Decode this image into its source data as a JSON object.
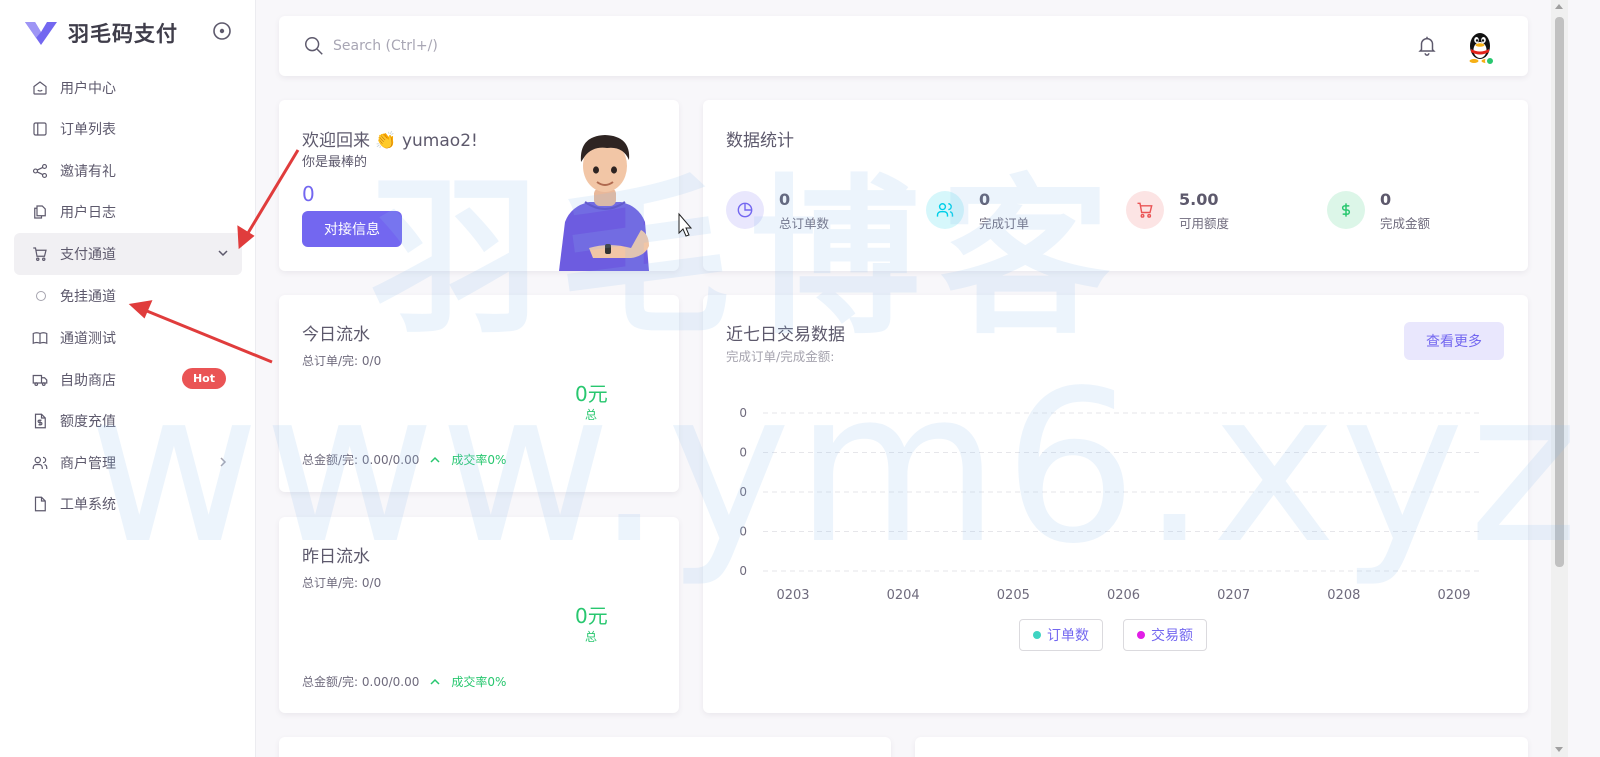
{
  "brand": {
    "name": "羽毛码支付"
  },
  "sidebar": {
    "items": [
      {
        "label": "用户中心",
        "icon": "home-icon"
      },
      {
        "label": "订单列表",
        "icon": "layout-icon"
      },
      {
        "label": "邀请有礼",
        "icon": "share-icon"
      },
      {
        "label": "用户日志",
        "icon": "files-icon"
      },
      {
        "label": "支付通道",
        "icon": "cart-icon",
        "expanded": true
      },
      {
        "label": "免挂通道",
        "icon": "circle-icon",
        "sub": true
      },
      {
        "label": "通道测试",
        "icon": "book-icon"
      },
      {
        "label": "自助商店",
        "icon": "truck-icon",
        "badge": "Hot"
      },
      {
        "label": "额度充值",
        "icon": "file-dollar-icon"
      },
      {
        "label": "商户管理",
        "icon": "users-icon"
      },
      {
        "label": "工单系统",
        "icon": "file-icon"
      }
    ]
  },
  "navbar": {
    "search_placeholder": "Search (Ctrl+/)"
  },
  "welcome": {
    "title": "欢迎回来 👏 yumao2!",
    "subtitle": "你是最棒的",
    "value": "0",
    "button": "对接信息"
  },
  "stats": {
    "title": "数据统计",
    "items": [
      {
        "value": "0",
        "label": "总订单数",
        "color": "#7367f0",
        "bg": "#e9e7fd",
        "icon": "pie-chart-icon"
      },
      {
        "value": "0",
        "label": "完成订单",
        "color": "#00cfe8",
        "bg": "#d6f7fb",
        "icon": "users-icon"
      },
      {
        "value": "5.00",
        "label": "可用额度",
        "color": "#ea5455",
        "bg": "#fce4e4",
        "icon": "cart-icon"
      },
      {
        "value": "0",
        "label": "完成金额",
        "color": "#28c76f",
        "bg": "#dcf6e8",
        "icon": "dollar-icon"
      }
    ]
  },
  "today": {
    "title": "今日流水",
    "orders": "总订单/完: 0/0",
    "amount": "0元",
    "total": "总",
    "foot_amount": "总金额/完: 0.00/0.00",
    "rate": "成交率0%"
  },
  "yesterday": {
    "title": "昨日流水",
    "orders": "总订单/完: 0/0",
    "amount": "0元",
    "total": "总",
    "foot_amount": "总金额/完: 0.00/0.00",
    "rate": "成交率0%"
  },
  "weekly": {
    "title": "近七日交易数据",
    "subtitle": "完成订单/完成金额:",
    "button": "查看更多"
  },
  "chart_data": {
    "type": "line",
    "x": [
      "0203",
      "0204",
      "0205",
      "0206",
      "0207",
      "0208",
      "0209"
    ],
    "y_ticks": [
      "0",
      "0",
      "0",
      "0",
      "0"
    ],
    "series": [
      {
        "name": "订单数",
        "values": [
          0,
          0,
          0,
          0,
          0,
          0,
          0
        ],
        "color": "#3fd4c2"
      },
      {
        "name": "交易额",
        "values": [
          0,
          0,
          0,
          0,
          0,
          0,
          0
        ],
        "color": "#e11ee6"
      }
    ],
    "grid": true,
    "legend": "bottom-center"
  },
  "watermark": {
    "line1": "羽毛博客",
    "line2": "www.ym6.xyz"
  }
}
